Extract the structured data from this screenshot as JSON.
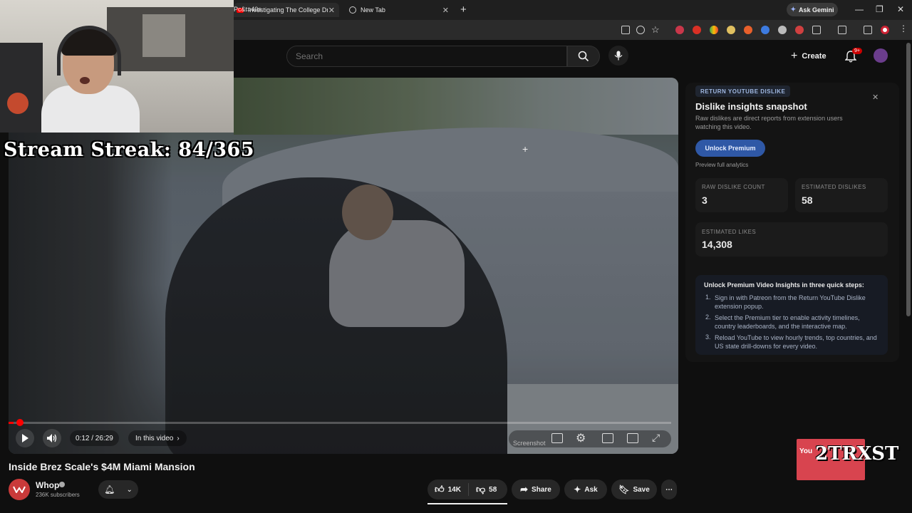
{
  "browser": {
    "tabs": [
      {
        "label": "Investigating The College Drop",
        "active": true
      },
      {
        "label": "New Tab",
        "active": false
      }
    ],
    "gemini_label": "Ask Gemini",
    "url": "Pc&t=40s"
  },
  "header": {
    "search_placeholder": "Search",
    "create_label": "Create",
    "notification_badge": "9+"
  },
  "overlay": {
    "stream_streak": "Stream Streak: 84/365",
    "sticker_text": "2TRXST",
    "sticker_small": "You"
  },
  "player": {
    "time": "0:12 / 26:29",
    "chapter_label": "In this video",
    "screenshot_label": "Screenshot",
    "progress": 0.008
  },
  "video": {
    "title": "Inside Brez Scale's $4M Miami Mansion",
    "channel": "Whop",
    "subscribers": "236K subscribers",
    "likes": "14K",
    "dislikes": "58",
    "share_label": "Share",
    "ask_label": "Ask",
    "save_label": "Save"
  },
  "rtd": {
    "tag": "RETURN YOUTUBE DISLIKE",
    "heading": "Dislike insights snapshot",
    "description": "Raw dislikes are direct reports from extension users watching this video.",
    "unlock_label": "Unlock Premium",
    "preview_label": "Preview full analytics",
    "raw_label": "RAW DISLIKE COUNT",
    "raw_value": "3",
    "est_dislikes_label": "ESTIMATED DISLIKES",
    "est_dislikes_value": "58",
    "est_likes_label": "ESTIMATED LIKES",
    "est_likes_value": "14,308",
    "steps_title": "Unlock Premium Video Insights in three quick steps:",
    "steps": [
      "Sign in with Patreon from the Return YouTube Dislike extension popup.",
      "Select the Premium tier to enable activity timelines, country leaderboards, and the interactive map.",
      "Reload YouTube to view hourly trends, top countries, and US state drill-downs for every video."
    ]
  },
  "colors": {
    "accent_red": "#ff0000",
    "premium_blue": "#2f58a6"
  }
}
